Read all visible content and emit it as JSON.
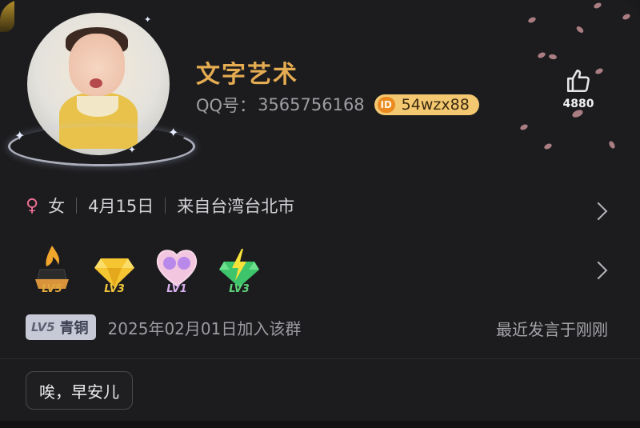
{
  "profile": {
    "name": "文字艺术",
    "qq_label": "QQ号：",
    "qq_number": "3565756168",
    "custom_id": "54wzx88",
    "id_icon": "ID",
    "likes": "4880"
  },
  "info": {
    "gender_icon": "♀",
    "gender": "女",
    "birthday": "4月15日",
    "location": "来自台湾台北市"
  },
  "badges": [
    {
      "icon": "flame-crown-icon",
      "level": "LV5",
      "color": "#e2a93c"
    },
    {
      "icon": "yellow-diamond-icon",
      "level": "LV3",
      "color": "#f0c63a"
    },
    {
      "icon": "pink-heart-icon",
      "level": "LV1",
      "color": "#d8b0f0"
    },
    {
      "icon": "green-bolt-diamond-icon",
      "level": "LV3",
      "color": "#5fd27a"
    }
  ],
  "group": {
    "level_code": "LV5",
    "level_name": "青铜",
    "joined": "2025年02月01日加入该群",
    "last_speak": "最近发言于刚刚"
  },
  "message": "唉，早安儿",
  "colors": {
    "name": "#e5ac52",
    "id_badge": "#f4c870",
    "gender": "#ef6f93"
  }
}
